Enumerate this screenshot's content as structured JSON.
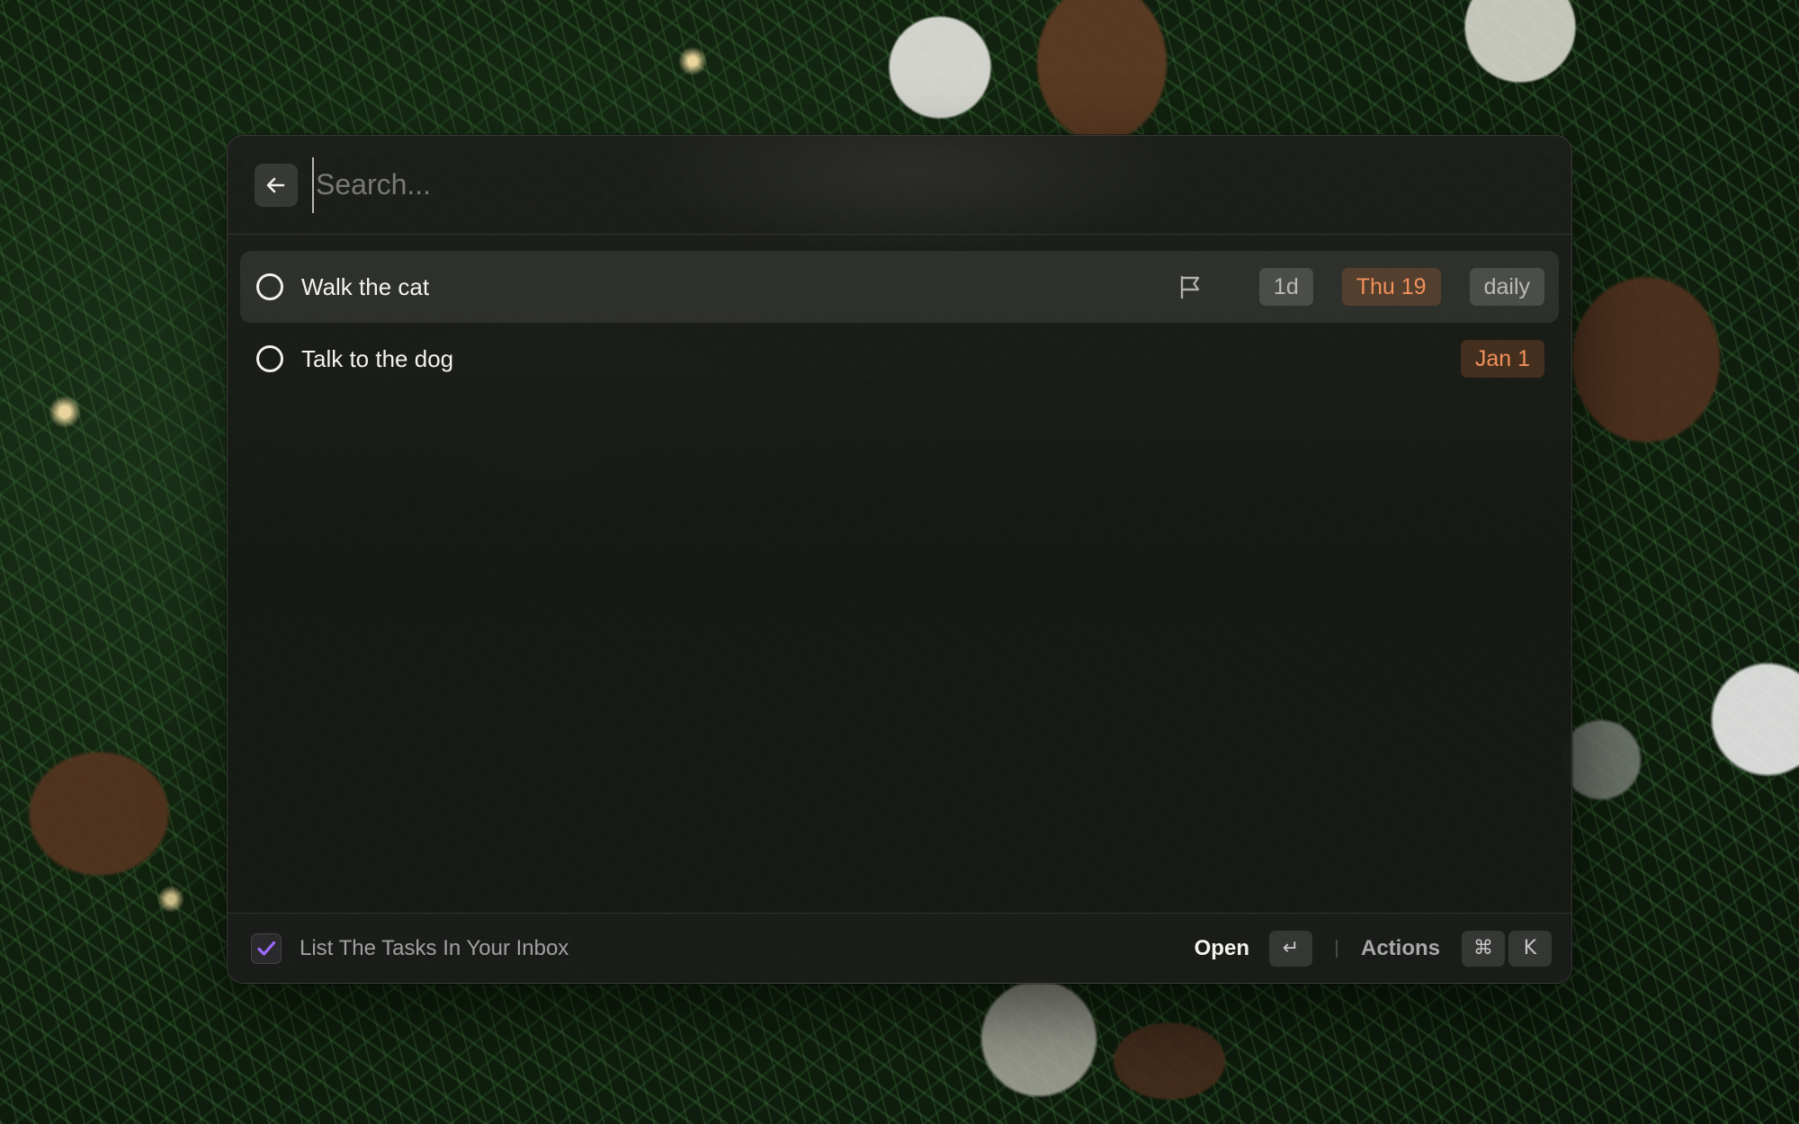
{
  "search": {
    "placeholder": "Search...",
    "value": ""
  },
  "tasks": [
    {
      "title": "Walk the cat",
      "selected": true,
      "flag_icon": "flag-icon",
      "badges": [
        {
          "label": "1d",
          "style": "gray"
        },
        {
          "label": "Thu 19",
          "style": "orange"
        },
        {
          "label": "daily",
          "style": "gray"
        }
      ]
    },
    {
      "title": "Talk to the dog",
      "selected": false,
      "badges": [
        {
          "label": "Jan 1",
          "style": "orange"
        }
      ]
    }
  ],
  "footer": {
    "app_icon": "checkmark-app-icon",
    "title": "List The Tasks In Your Inbox",
    "primary_action": "Open",
    "primary_key": "↵",
    "actions_label": "Actions",
    "actions_keys": [
      "⌘",
      "K"
    ]
  },
  "colors": {
    "accent_orange": "#f0905a",
    "app_icon_purple": "#9b6bff"
  }
}
